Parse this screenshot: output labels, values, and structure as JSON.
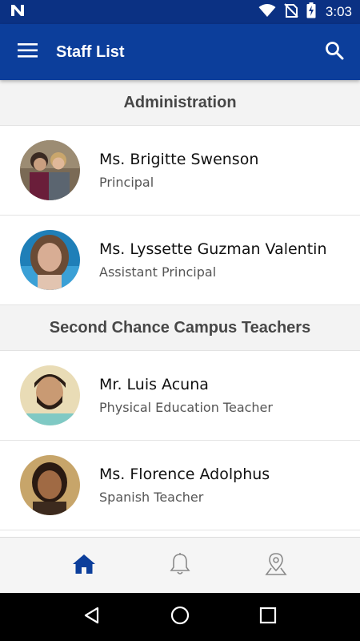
{
  "status_bar": {
    "time": "3:03"
  },
  "app_bar": {
    "title": "Staff List"
  },
  "sections": [
    {
      "title": "Administration",
      "staff": [
        {
          "name": "Ms. Brigitte Swenson",
          "role": "Principal"
        },
        {
          "name": "Ms. Lyssette Guzman Valentin",
          "role": "Assistant Principal"
        }
      ]
    },
    {
      "title": "Second Chance Campus Teachers",
      "staff": [
        {
          "name": "Mr. Luis Acuna",
          "role": "Physical Education Teacher"
        },
        {
          "name": "Ms. Florence Adolphus",
          "role": "Spanish Teacher"
        }
      ]
    }
  ],
  "bottom_nav": {
    "items": [
      {
        "icon": "home-icon",
        "active": true
      },
      {
        "icon": "bell-icon",
        "active": false
      },
      {
        "icon": "map-pin-icon",
        "active": false
      }
    ]
  },
  "colors": {
    "status_bar": "#0b3183",
    "app_bar": "#0c3e9b",
    "nav_active": "#0c3e9b",
    "nav_inactive": "#8a8a8a",
    "section_header_bg": "#f3f3f3"
  }
}
